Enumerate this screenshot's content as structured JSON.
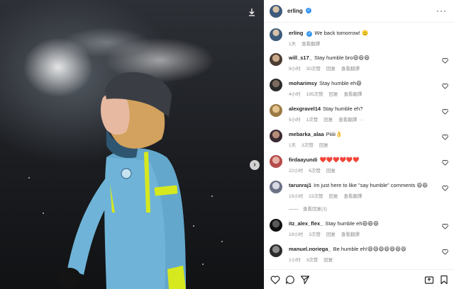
{
  "post": {
    "author": "erling",
    "caption": "We back tomorrow! 🫡",
    "caption_time": "1天",
    "caption_translate": "查看翻譯"
  },
  "comments": [
    {
      "user": "will_s17_",
      "text": "Stay humble bro😄😄😄",
      "time": "9小时",
      "likes": "30次赞",
      "reply": "回复",
      "translate": "查看翻譯"
    },
    {
      "user": "moharimsy",
      "text": "Stay humble eh😄",
      "time": "4小时",
      "likes": "195次赞",
      "reply": "回复",
      "translate": "查看翻譯"
    },
    {
      "user": "alexgravel14",
      "text": "Stay humble eh?",
      "time": "5小时",
      "likes": "1次赞",
      "reply": "回复",
      "translate": "查看翻譯"
    },
    {
      "user": "mebarka_alaa",
      "text": "Piiiii👌",
      "time": "1天",
      "likes": "3次赞",
      "reply": "回复",
      "translate": ""
    },
    {
      "user": "firdaayundi",
      "text": "❤️❤️❤️❤️❤️❤️",
      "time": "22小时",
      "likes": "6次赞",
      "reply": "回复",
      "translate": ""
    },
    {
      "user": "tarunraj1",
      "text": "Im just here to like \"say humble\" comments 😄😄",
      "time": "15小时",
      "likes": "23次赞",
      "reply": "回复",
      "translate": "查看翻譯"
    },
    {
      "user": "itz_alex_flex_",
      "text": "Stay humble eh😄😄😄",
      "time": "19小时",
      "likes": "3次赞",
      "reply": "回复",
      "translate": "查看翻譯"
    },
    {
      "user": "manuel.noriega_",
      "text": "Be humble eh!😄😄😄😄😄😄😄",
      "time": "1小时",
      "likes": "3次赞",
      "reply": "回复",
      "translate": ""
    }
  ],
  "view_replies": "查看回复(3)",
  "icons": {
    "download": "download-icon",
    "next": "chevron-right-icon",
    "like": "heart-icon",
    "comment": "comment-icon",
    "share": "share-icon",
    "save": "bookmark-icon",
    "more": "more-icon",
    "verified": "verified-badge-icon"
  },
  "colors": {
    "verified": "#3897f0",
    "jersey": "#6fb4d8",
    "beanie": "#3a3e44",
    "accent_yellow": "#d6e81e"
  }
}
